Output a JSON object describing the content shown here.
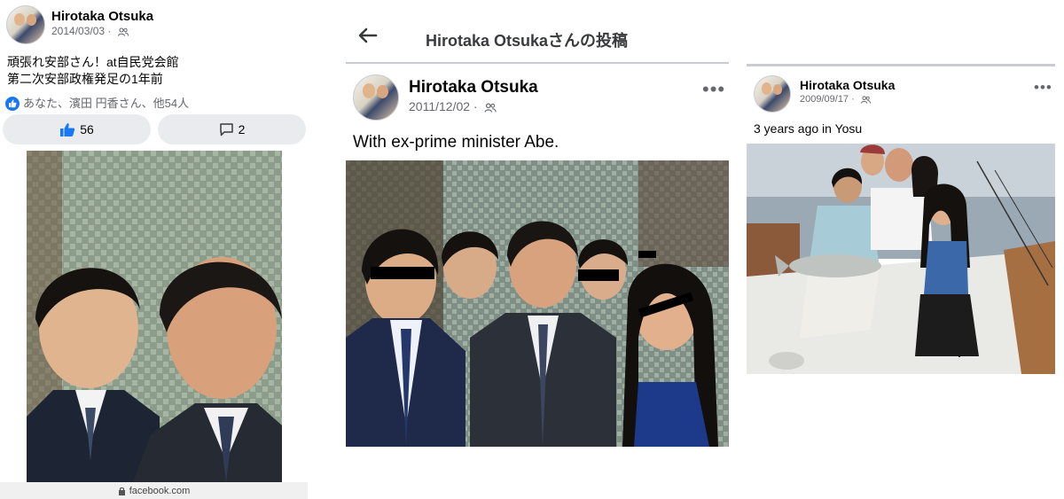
{
  "panel1": {
    "author": "Hirotaka Otsuka",
    "date": "2014/03/03",
    "post_lines": [
      "頑張れ安部さん！at自民党会館",
      "第二次安部政権発足の1年前"
    ],
    "reactions_text": "あなた、濱田 円香さん、他54人",
    "like_count": "56",
    "comment_count": "2",
    "url": "facebook.com",
    "privacy_icon": "friends-icon"
  },
  "panel2": {
    "header_title": "Hirotaka Otsukaさんの投稿",
    "back_icon": "back-arrow-icon",
    "author": "Hirotaka Otsuka",
    "date": "2011/12/02",
    "caption": "With ex-prime minister Abe."
  },
  "panel3": {
    "author": "Hirotaka Otsuka",
    "date": "2009/09/17",
    "caption": "3 years ago in Yosu"
  },
  "colors": {
    "facebook_blue": "#1877f2",
    "secondary_text": "#65676b",
    "pill_bg": "#e9ebee"
  }
}
